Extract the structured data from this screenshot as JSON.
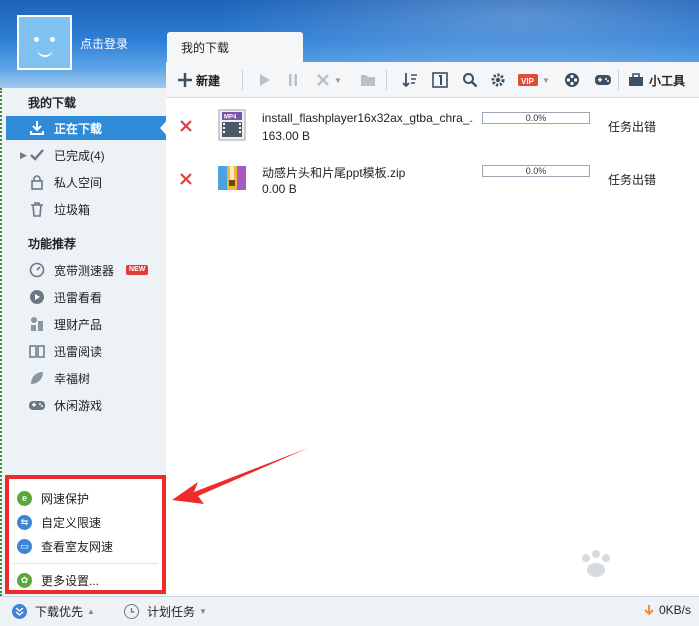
{
  "header": {
    "login_label": "点击登录",
    "tab_label": "我的下载"
  },
  "sidebar": {
    "section_downloads": "我的下载",
    "items": [
      {
        "label": "正在下载",
        "icon": "download-icon"
      },
      {
        "label": "已完成(4)",
        "icon": "checkmark-icon"
      },
      {
        "label": "私人空间",
        "icon": "lock-icon"
      },
      {
        "label": "垃圾箱",
        "icon": "trash-icon"
      }
    ],
    "section_features": "功能推荐",
    "features": [
      {
        "label": "宽带测速器",
        "icon": "speedometer-icon",
        "badge": "NEW"
      },
      {
        "label": "迅雷看看",
        "icon": "kankan-icon"
      },
      {
        "label": "理财产品",
        "icon": "coins-icon"
      },
      {
        "label": "迅雷阅读",
        "icon": "book-icon"
      },
      {
        "label": "幸福树",
        "icon": "leaf-icon"
      },
      {
        "label": "休闲游戏",
        "icon": "gamepad-icon"
      }
    ]
  },
  "toolbar": {
    "new_label": "新建",
    "tools_label": "小工具"
  },
  "downloads": [
    {
      "name": "install_flashplayer16x32ax_gtba_chra_...",
      "size": "163.00 B",
      "progress": "0.0%",
      "status": "任务出错",
      "icon": "mp4-file-icon"
    },
    {
      "name": "动感片头和片尾ppt模板.zip",
      "size": "0.00 B",
      "progress": "0.0%",
      "status": "任务出错",
      "icon": "zip-archive-icon"
    }
  ],
  "popup": {
    "items": [
      {
        "label": "网速保护",
        "icon": "shield-icon",
        "color": "#58a83a"
      },
      {
        "label": "自定义限速",
        "icon": "swap-icon",
        "color": "#3c86d4"
      },
      {
        "label": "查看室友网速",
        "icon": "monitor-icon",
        "color": "#3c86d4"
      }
    ],
    "settings_label": "更多设置...",
    "settings_color": "#58a83a"
  },
  "statusbar": {
    "priority_label": "下载优先",
    "schedule_label": "计划任务",
    "speed": "0KB/s"
  },
  "colors": {
    "accent": "#2f8ad8",
    "error_x": "#e04040",
    "highlight_border": "#ef2a2a"
  }
}
